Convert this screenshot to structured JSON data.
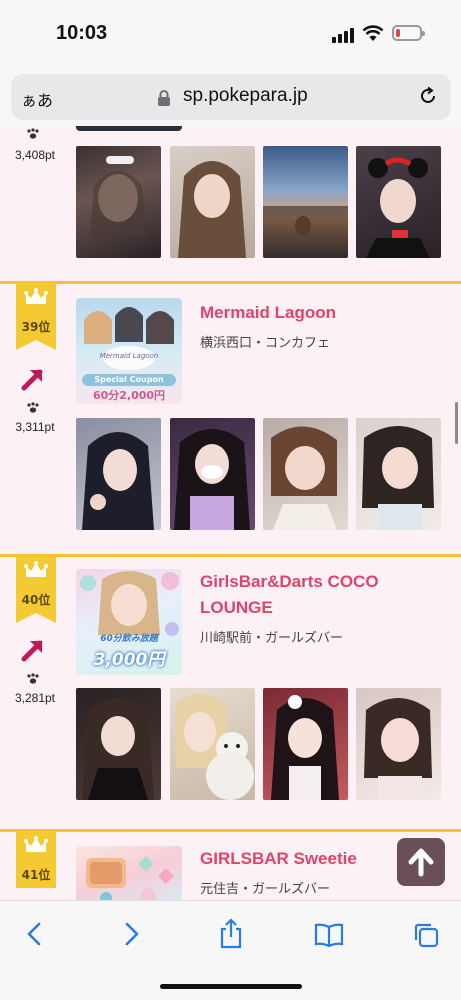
{
  "status": {
    "time": "10:03"
  },
  "browser": {
    "aa_label": "ぁあ",
    "url": "sp.pokepara.jp"
  },
  "top_entry": {
    "points": "3,408pt"
  },
  "entries": [
    {
      "rank": "39位",
      "name": "Mermaid Lagoon",
      "area": "横浜西口・コンカフェ",
      "points": "3,311pt",
      "trend": "up",
      "banner_text": [
        "Mermaid Lagoon",
        "Special Coupon",
        "60分2,000円"
      ]
    },
    {
      "rank": "40位",
      "name": "GirlsBar&Darts COCO LOUNGE",
      "area": "川崎駅前・ガールズバー",
      "points": "3,281pt",
      "trend": "up",
      "banner_text": [
        "60分飲み放題",
        "3,000円"
      ]
    },
    {
      "rank": "41位",
      "name": "GIRLSBAR Sweetie",
      "area": "元住吉・ガールズバー"
    }
  ],
  "colors": {
    "accent_pink": "#e0446a",
    "rank_gold": "#f5c932",
    "trend_arrow": "#c2185b",
    "background": "#fcf1f5"
  },
  "icons": [
    "cellular-signal-icon",
    "wifi-icon",
    "battery-icon",
    "lock-icon",
    "reload-icon",
    "crown-icon",
    "paw-icon",
    "trend-up-icon",
    "arrow-up-icon",
    "back-icon",
    "forward-icon",
    "share-icon",
    "bookmarks-icon",
    "tabs-icon"
  ]
}
